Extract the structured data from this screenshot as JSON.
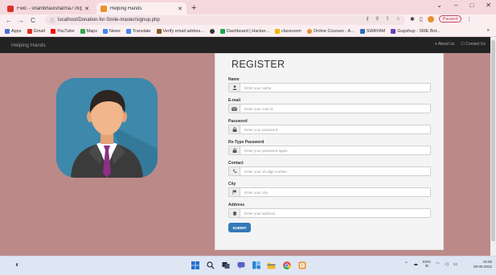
{
  "browser": {
    "tabs": [
      {
        "title": "Fwd: - shambhavisharma778@g",
        "favicon_color": "#d93025",
        "active": false
      },
      {
        "title": "Helping Hands",
        "favicon_color": "#e8912d",
        "active": true
      }
    ],
    "new_tab": "+",
    "window_controls": {
      "minimize": "–",
      "restore": "□",
      "close": "✕"
    },
    "nav": {
      "back": "←",
      "forward": "→",
      "reload": "C"
    },
    "url": "localhost/Donation-for-Smile-master/signup.php",
    "profile_status": "Paused",
    "bookmarks": [
      {
        "label": "Apps",
        "color": "#4a6fd8"
      },
      {
        "label": "Gmail",
        "color": "#d93025"
      },
      {
        "label": "YouTube",
        "color": "#ff0000"
      },
      {
        "label": "Maps",
        "color": "#34a853"
      },
      {
        "label": "News",
        "color": "#4285f4"
      },
      {
        "label": "Translate",
        "color": "#4285f4"
      },
      {
        "label": "Verify email addres...",
        "color": "#8a5a2b"
      },
      {
        "label": "",
        "color": "#333333"
      },
      {
        "label": "Dashboard | Hacker...",
        "color": "#1ba94c"
      },
      {
        "label": "classroom",
        "color": "#f4b400"
      },
      {
        "label": "Online Courses - A...",
        "color": "#e8912d"
      },
      {
        "label": "SWAYAM",
        "color": "#2a6ebb"
      },
      {
        "label": "Gupshup - SME Bot...",
        "color": "#6a3fb5"
      }
    ],
    "bookmarks_more": "»"
  },
  "site": {
    "brand": "Helping Hands",
    "nav_links": [
      {
        "icon": "≡",
        "label": "About Us"
      },
      {
        "icon": "☐",
        "label": "Contact Us"
      }
    ]
  },
  "form": {
    "title": "REGISTER",
    "fields": [
      {
        "label": "Name",
        "icon": "👤",
        "placeholder": "Enter your name."
      },
      {
        "label": "E-mail",
        "icon": "✉",
        "placeholder": "Enter your mail id."
      },
      {
        "label": "Password",
        "icon": "🔒",
        "placeholder": "Enter your password."
      },
      {
        "label": "Re-Type Password",
        "icon": "🔒",
        "placeholder": "Enter your password again."
      },
      {
        "label": "Contact",
        "icon": "☎",
        "placeholder": "Enter your 10 digit number."
      },
      {
        "label": "City",
        "icon": "⚑",
        "placeholder": "Enter your city."
      },
      {
        "label": "Address",
        "icon": "⌂",
        "placeholder": "Enter your address."
      }
    ],
    "submit_label": "SUBMIT"
  },
  "taskbar": {
    "apps": [
      {
        "name": "start",
        "color": "#1f6fd1"
      },
      {
        "name": "search",
        "color": "#1e2a3a"
      },
      {
        "name": "task-view",
        "color": "#1e2a3a"
      },
      {
        "name": "chat",
        "color": "#5b5fc7"
      },
      {
        "name": "widgets",
        "color": "#2b88d8"
      },
      {
        "name": "file-explorer",
        "color": "#f2b632"
      },
      {
        "name": "chrome",
        "color": "#e8453c"
      },
      {
        "name": "sublime",
        "color": "#e8912d"
      }
    ],
    "lang_top": "ENG",
    "lang_bottom": "IN",
    "time": "15:05",
    "date": "09-05-2022"
  },
  "colors": {
    "page_background": "#bc8989",
    "navbar": "#222222",
    "submit": "#337ab7"
  }
}
